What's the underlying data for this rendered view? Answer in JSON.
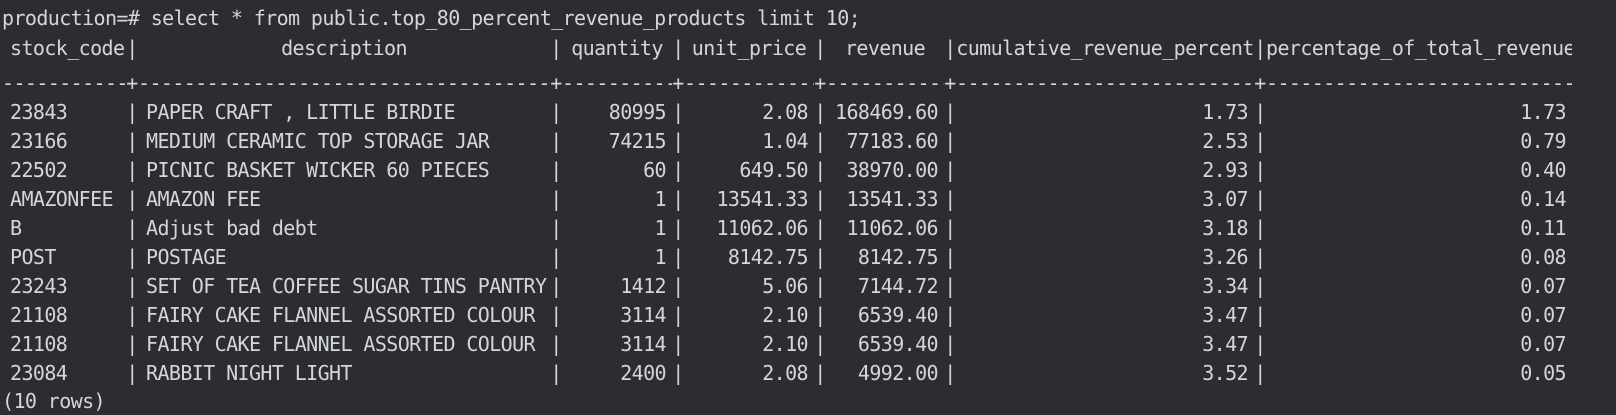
{
  "terminal": {
    "prompt": "production=# ",
    "command": "select * from public.top_80_percent_revenue_products limit 10;",
    "footer": "(10 rows)"
  },
  "table": {
    "columns": [
      "stock_code",
      "description",
      "quantity",
      "unit_price",
      "revenue",
      "cumulative_revenue_percent",
      "percentage_of_total_revenue"
    ],
    "rows": [
      [
        "23843",
        "PAPER CRAFT , LITTLE BIRDIE",
        "80995",
        "2.08",
        "168469.60",
        "1.73",
        "1.73"
      ],
      [
        "23166",
        "MEDIUM CERAMIC TOP STORAGE JAR",
        "74215",
        "1.04",
        "77183.60",
        "2.53",
        "0.79"
      ],
      [
        "22502",
        "PICNIC BASKET WICKER 60 PIECES",
        "60",
        "649.50",
        "38970.00",
        "2.93",
        "0.40"
      ],
      [
        "AMAZONFEE",
        "AMAZON FEE",
        "1",
        "13541.33",
        "13541.33",
        "3.07",
        "0.14"
      ],
      [
        "B",
        "Adjust bad debt",
        "1",
        "11062.06",
        "11062.06",
        "3.18",
        "0.11"
      ],
      [
        "POST",
        "POSTAGE",
        "1",
        "8142.75",
        "8142.75",
        "3.26",
        "0.08"
      ],
      [
        "23243",
        "SET OF TEA COFFEE SUGAR TINS PANTRY",
        "1412",
        "5.06",
        "7144.72",
        "3.34",
        "0.07"
      ],
      [
        "21108",
        "FAIRY CAKE FLANNEL ASSORTED COLOUR",
        "3114",
        "2.10",
        "6539.40",
        "3.47",
        "0.07"
      ],
      [
        "21108",
        "FAIRY CAKE FLANNEL ASSORTED COLOUR",
        "3114",
        "2.10",
        "6539.40",
        "3.47",
        "0.07"
      ],
      [
        "23084",
        "RABBIT NIGHT LIGHT",
        "2400",
        "2.08",
        "4992.00",
        "3.52",
        "0.05"
      ]
    ]
  },
  "colors": {
    "background": "#2b2d31",
    "foreground": "#d4d6da"
  }
}
